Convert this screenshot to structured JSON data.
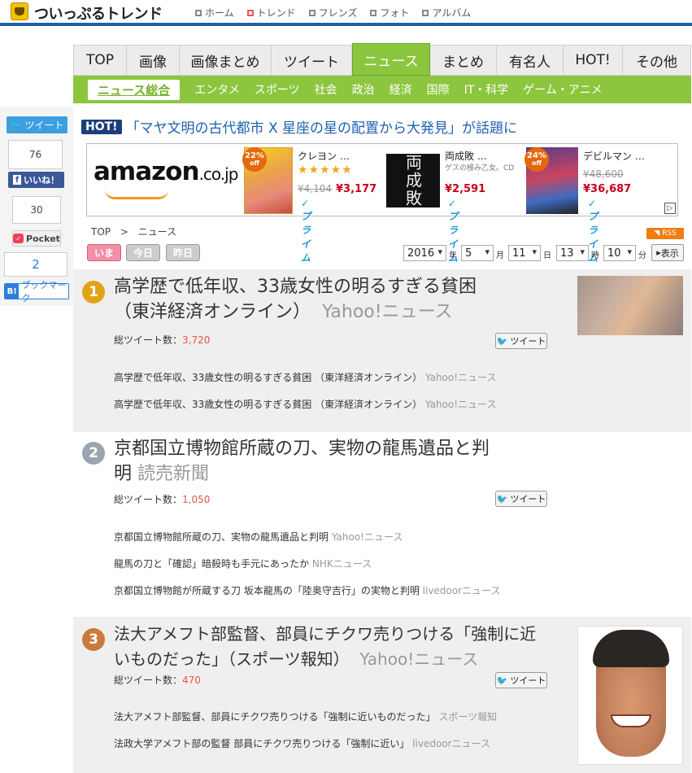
{
  "header": {
    "logo": "ついっぷるトレンド",
    "nav": [
      "ホーム",
      "トレンド",
      "フレンズ",
      "フォト",
      "アルバム"
    ]
  },
  "tabs": [
    "TOP",
    "画像",
    "画像まとめ",
    "ツイート",
    "ニュース",
    "まとめ",
    "有名人",
    "HOT!",
    "その他"
  ],
  "subnav": [
    "ニュース総合",
    "エンタメ",
    "スポーツ",
    "社会",
    "政治",
    "経済",
    "国際",
    "IT・科学",
    "ゲーム・アニメ"
  ],
  "share": {
    "tweet": "ツイート",
    "tweet_count": "76",
    "like": "いいね！",
    "like_count": "30",
    "pocket": "Pocket",
    "pocket_count": "2",
    "hatena": "ブックマーク",
    "hatena_b": "B!"
  },
  "hot": {
    "badge": "HOT!",
    "title": "「マヤ文明の古代都市 X 星座の星の配置から大発見」が話題に"
  },
  "ad": {
    "logo": "amazon",
    "logo_suffix": ".co.jp",
    "products": [
      {
        "name": "クレヨン …",
        "off": "22%",
        "off_label": "off",
        "stars": "★★★★★",
        "old": "¥4,104",
        "new": "¥3,177",
        "prime": "✓プライム"
      },
      {
        "name": "両成敗 …",
        "sub": "ゲスの極み乙女。CD",
        "new": "¥2,591",
        "prime": "✓プライム",
        "cover": "両成敗"
      },
      {
        "name": "デビルマン …",
        "off": "24%",
        "off_label": "off",
        "old": "¥48,600",
        "new": "¥36,687",
        "prime": "✓プライム"
      }
    ]
  },
  "crumb": {
    "top": "TOP",
    "sep": ">",
    "current": "ニュース"
  },
  "rss": "RSS",
  "time_buttons": [
    "いま",
    "今日",
    "昨日"
  ],
  "selectors": {
    "year": "2016",
    "year_u": "年",
    "month": "5",
    "month_u": "月",
    "day": "11",
    "day_u": "日",
    "hour": "13",
    "hour_u": "時",
    "minute": "10",
    "minute_u": "分",
    "show": "表示"
  },
  "tweet_count_label": "総ツイート数：",
  "tweet_btn": "ツイート",
  "articles": [
    {
      "rank": "1",
      "title_l1": "高学歴で低年収、33歳女性の明るすぎる貧困",
      "title_l2": "（東洋経済オンライン）",
      "source": "Yahoo!ニュース",
      "count": "3,720",
      "related": [
        {
          "text": "高学歴で低年収、33歳女性の明るすぎる貧困 （東洋経済オンライン）",
          "src": "Yahoo!ニュース"
        },
        {
          "text": "高学歴で低年収、33歳女性の明るすぎる貧困 （東洋経済オンライン）",
          "src": "Yahoo!ニュース"
        }
      ]
    },
    {
      "rank": "2",
      "title_l1": "京都国立博物館所蔵の刀、実物の龍馬遺品と判",
      "title_l2": "明",
      "source": "読売新聞",
      "count": "1,050",
      "related": [
        {
          "text": "京都国立博物館所蔵の刀、実物の龍馬遺品と判明",
          "src": "Yahoo!ニュース"
        },
        {
          "text": "龍馬の刀と「確認」暗殺時も手元にあったか",
          "src": "NHKニュース"
        },
        {
          "text": "京都国立博物館が所蔵する刀 坂本龍馬の「陸奥守吉行」の実物と判明",
          "src": "livedoorニュース"
        }
      ]
    },
    {
      "rank": "3",
      "title_l1": "法大アメフト部監督、部員にチクワ売りつける「強制に近",
      "title_l2": "いものだった」（スポーツ報知）",
      "source": "Yahoo!ニュース",
      "count": "470",
      "related": [
        {
          "text": "法大アメフト部監督、部員にチクワ売りつける「強制に近いものだった」",
          "src": "スポーツ報知"
        },
        {
          "text": "法政大学アメフト部の監督 部員にチクワ売りつける「強制に近い」",
          "src": "livedoorニュース"
        }
      ]
    }
  ],
  "colors": {
    "brand_blue": "#1f5fa8",
    "tab_green": "#8cc63f",
    "hot_link": "#2060b0",
    "count_red": "#e8534a",
    "rank_gold": "#e0a317",
    "rank_silver": "#9aa5b0",
    "rank_bronze": "#c97a3c"
  }
}
